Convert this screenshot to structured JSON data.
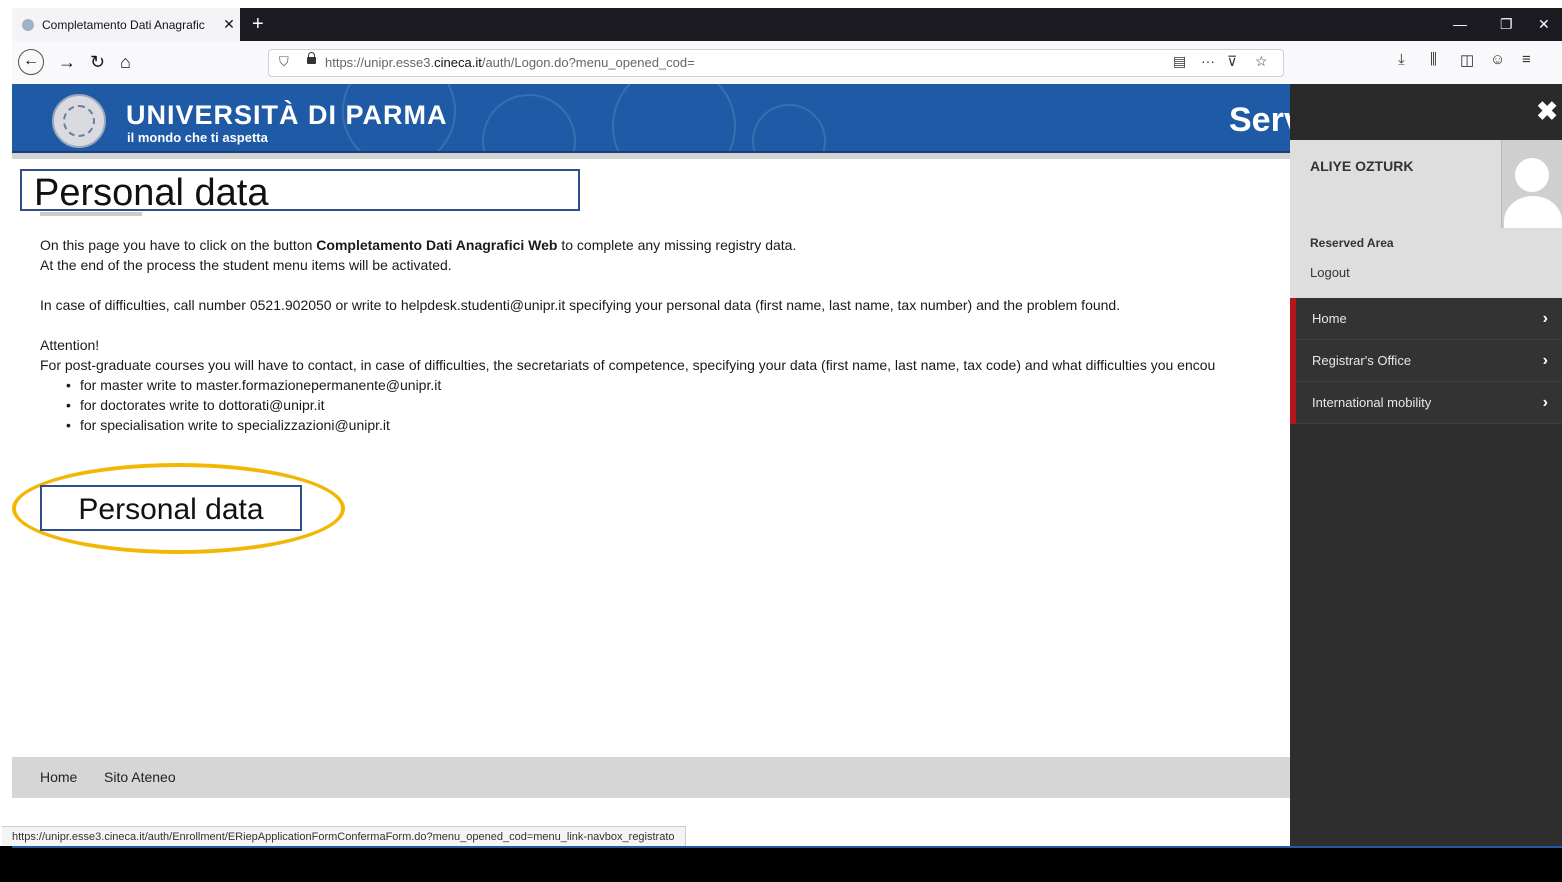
{
  "browser": {
    "tab_title": "Completamento Dati Anagrafic",
    "tab_close": "✕",
    "new_tab": "+",
    "url_prefix": "https://unipr.esse3.",
    "url_domain": "cineca.it",
    "url_path": "/auth/Logon.do?menu_opened_cod=",
    "status_url": "https://unipr.esse3.cineca.it/auth/Enrollment/ERiepApplicationFormConfermaForm.do?menu_opened_cod=menu_link-navbox_registrato"
  },
  "header": {
    "university": "UNIVERSITÀ DI PARMA",
    "tagline": "il mondo che ti aspetta",
    "services_partial": "Serv"
  },
  "main": {
    "title": "Personal data",
    "intro_pre": "On this page you have to click on the button ",
    "intro_bold": "Completamento Dati Anagrafici Web",
    "intro_post": " to complete any missing registry data.",
    "line2": "At the end of the process the student menu items will be activated.",
    "difficulties": "In case of difficulties, call number 0521.902050 or write to helpdesk.studenti@unipr.it specifying your personal data (first name, last name, tax number) and the problem found.",
    "attention": "Attention!",
    "postgrad": "For post-graduate courses you will have to contact, in case of difficulties, the secretariats of competence, specifying your data (first name, last name, tax code) and what difficulties you encou",
    "contacts": [
      "for master write to master.formazionepermanente@unipr.it",
      "for doctorates write to dottorati@unipr.it",
      "for specialisation write to specializzazioni@unipr.it"
    ],
    "button_label": "Personal data"
  },
  "footer": {
    "home": "Home",
    "sito": "Sito Ateneo"
  },
  "side_panel": {
    "close": "✖",
    "user_name": "ALIYE OZTURK",
    "reserved_area": "Reserved Area",
    "logout": "Logout",
    "menu": [
      {
        "label": "Home"
      },
      {
        "label": "Registrar's Office"
      },
      {
        "label": "International mobility"
      }
    ]
  },
  "colors": {
    "header_blue": "#1f5aa6",
    "highlight": "#f2b705",
    "menu_accent": "#b3161d"
  }
}
